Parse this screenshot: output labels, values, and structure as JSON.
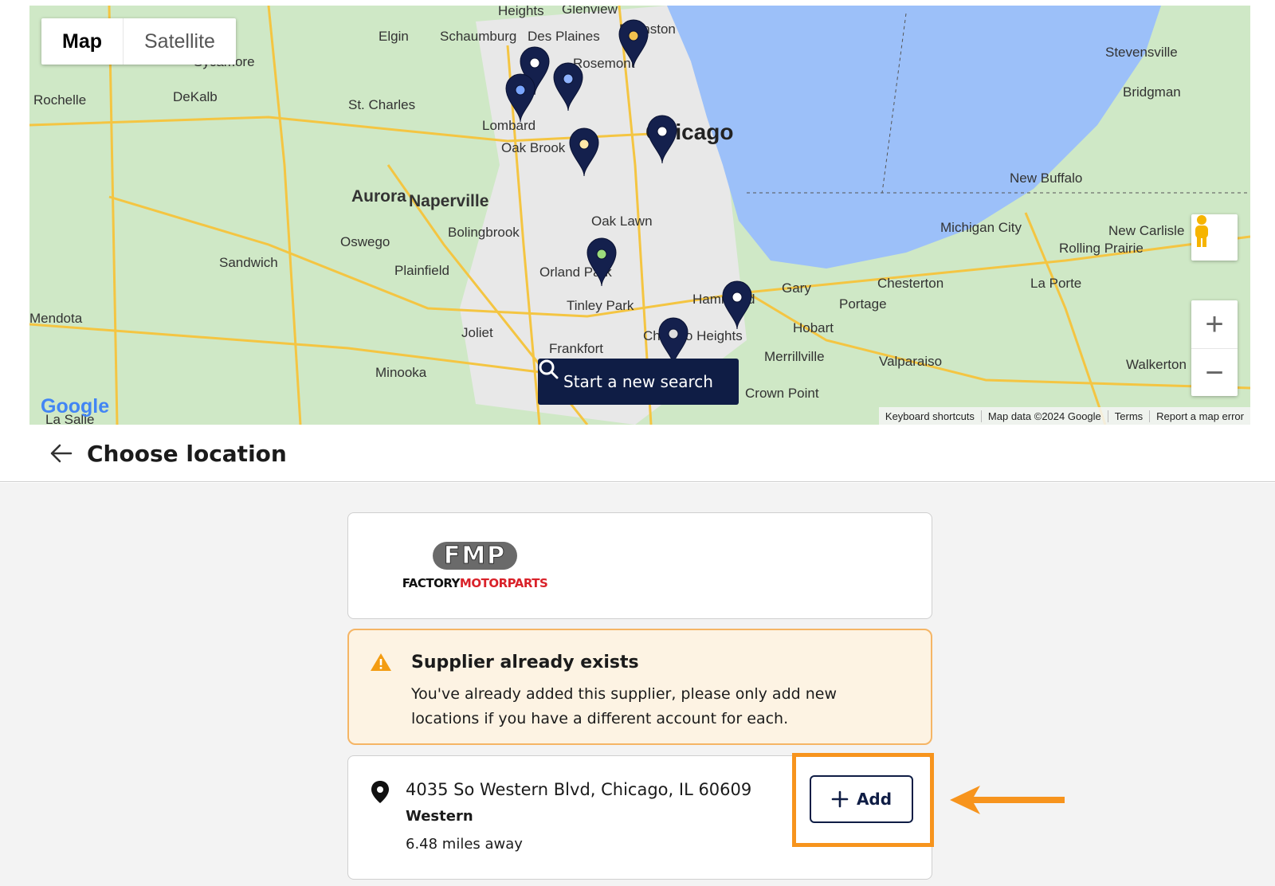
{
  "map": {
    "type_buttons": [
      "Map",
      "Satellite"
    ],
    "search_button": "Start a new search",
    "google_logo": "Google",
    "footer": [
      "Keyboard shortcuts",
      "Map data ©2024 Google",
      "Terms",
      "Report a map error"
    ],
    "zoom_in": "+",
    "zoom_out": "−",
    "city_labels": [
      "Chicago",
      "Evanston",
      "Des Plaines",
      "Schaumburg",
      "Elgin",
      "Rosemont",
      "Lombard",
      "Oak Brook",
      "St. Charles",
      "DeKalb",
      "Rochelle",
      "Sycamore",
      "Aurora",
      "Naperville",
      "Bolingbrook",
      "Oswego",
      "Oak Lawn",
      "Orland Park",
      "Tinley Park",
      "Plainfield",
      "Sandwich",
      "Joliet",
      "Frankfort",
      "Chicago Heights",
      "Minooka",
      "Hammond",
      "Gary",
      "Hobart",
      "Merrillville",
      "Portage",
      "Chesterton",
      "Valparaiso",
      "Crown Point",
      "Michigan City",
      "New Buffalo",
      "La Porte",
      "Rolling Prairie",
      "New Carlisle",
      "Stevensville",
      "Bridgman",
      "Walkerton",
      "Heights",
      "Glenview",
      "Mendota",
      "La Salle"
    ]
  },
  "header": {
    "title": "Choose location"
  },
  "supplier": {
    "logo_mark": "FMP",
    "logo_word_1": "FACTORY",
    "logo_word_2": "MOTORPARTS"
  },
  "warning": {
    "title": "Supplier already exists",
    "text": "You've already added this supplier, please only add new locations if you have a different account for each."
  },
  "location": {
    "address": "4035 So Western Blvd, Chicago, IL 60609",
    "name": "Western",
    "distance": "6.48 miles away",
    "add_label": "Add"
  },
  "colors": {
    "navy": "#0f1d45",
    "highlight": "#f7941d",
    "warning_bg": "#fdf3e3",
    "warning_border": "#f5b565",
    "lake": "#9cc0f9",
    "land": "#cfe8c6"
  }
}
